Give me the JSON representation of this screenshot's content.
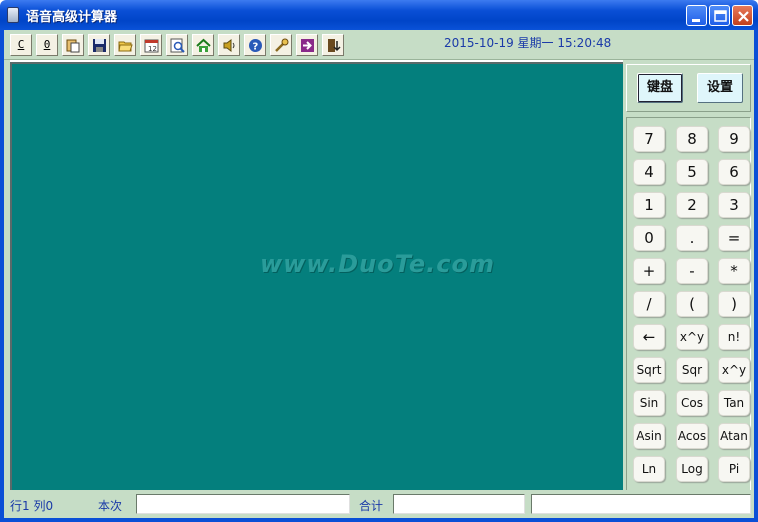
{
  "window": {
    "title": "语音高级计算器"
  },
  "toolbar": {
    "buttons": [
      {
        "label": "C",
        "icon": "clear-text"
      },
      {
        "label": "0",
        "icon": "zero-text"
      },
      {
        "icon": "paste-icon"
      },
      {
        "icon": "save-icon"
      },
      {
        "icon": "open-folder-icon"
      },
      {
        "icon": "calendar-icon"
      },
      {
        "icon": "preview-icon"
      },
      {
        "icon": "home-icon"
      },
      {
        "icon": "speaker-icon"
      },
      {
        "icon": "help-icon"
      },
      {
        "icon": "tools-icon"
      },
      {
        "icon": "forward-icon"
      },
      {
        "icon": "exit-icon"
      }
    ],
    "datetime": "2015-10-19 星期一 15:20:48"
  },
  "display": {
    "watermark": "www.DuoTe.com",
    "background": "#047f7d"
  },
  "mode_tabs": {
    "keyboard": "键盘",
    "settings": "设置"
  },
  "keypad": {
    "rows": [
      [
        "7",
        "8",
        "9"
      ],
      [
        "4",
        "5",
        "6"
      ],
      [
        "1",
        "2",
        "3"
      ],
      [
        "0",
        ".",
        "="
      ],
      [
        "+",
        "-",
        "*"
      ],
      [
        "/",
        "(",
        ")"
      ],
      [
        "←",
        "x^y",
        "n!"
      ],
      [
        "Sqrt",
        "Sqr",
        "x^y"
      ],
      [
        "Sin",
        "Cos",
        "Tan"
      ],
      [
        "Asin",
        "Acos",
        "Atan"
      ],
      [
        "Ln",
        "Log",
        "Pi"
      ]
    ]
  },
  "statusbar": {
    "position": "行1 列0",
    "current_label": "本次",
    "current_value": "",
    "total_label": "合计",
    "total_value": "",
    "extra_value": ""
  }
}
